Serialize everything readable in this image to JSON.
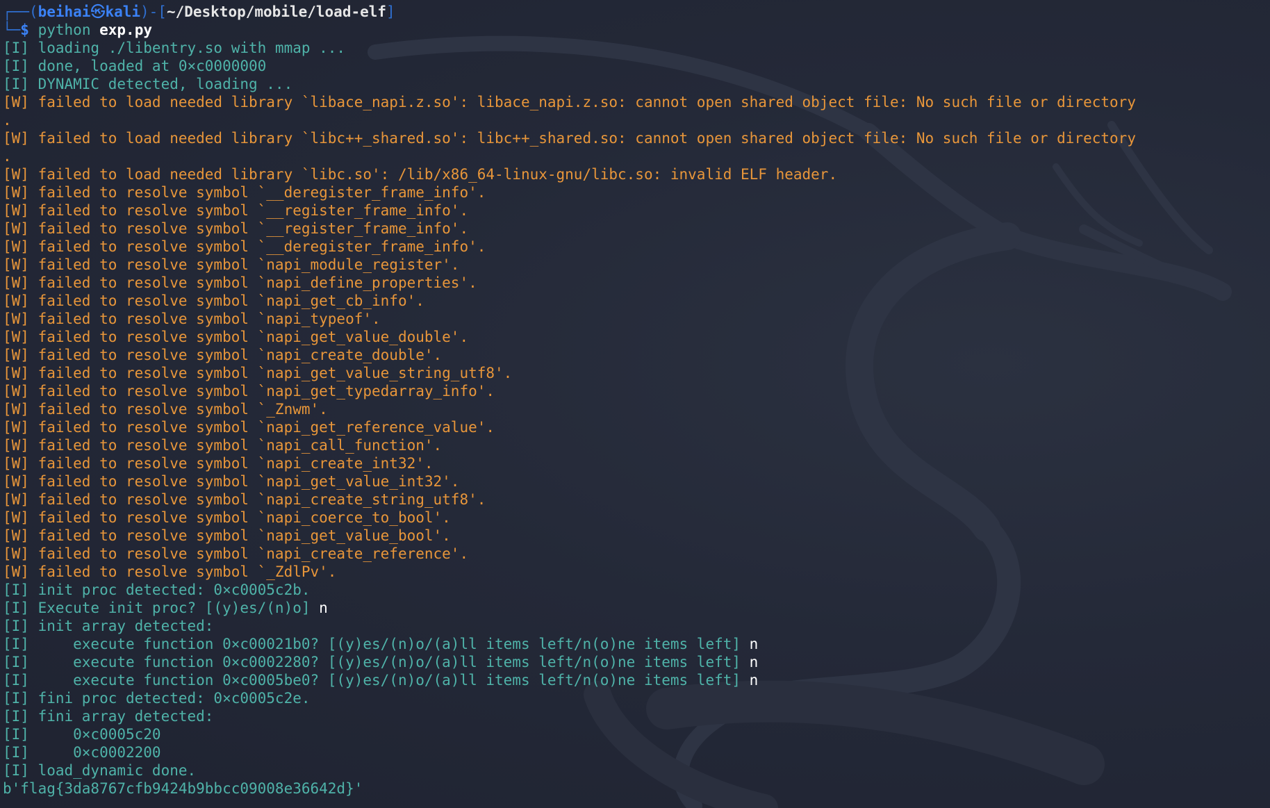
{
  "prompt": {
    "frame_top_left": "┌──(",
    "user": "beihai",
    "at_symbol": "㉿",
    "host": "kali",
    "frame_mid": ")-[",
    "path": "~/Desktop/mobile/load-elf",
    "frame_end": "]",
    "frame_bottom_left": "└─",
    "dollar": "$",
    "command": "python",
    "command_arg": "exp.py"
  },
  "output": [
    {
      "kind": "info",
      "text": "[I] loading ./libentry.so with mmap ..."
    },
    {
      "kind": "info",
      "text": "[I] done, loaded at 0×c0000000"
    },
    {
      "kind": "info",
      "text": "[I] DYNAMIC detected, loading ..."
    },
    {
      "kind": "warn",
      "text": "[W] failed to load needed library `libace_napi.z.so': libace_napi.z.so: cannot open shared object file: No such file or directory"
    },
    {
      "kind": "warn",
      "text": "."
    },
    {
      "kind": "warn",
      "text": "[W] failed to load needed library `libc++_shared.so': libc++_shared.so: cannot open shared object file: No such file or directory"
    },
    {
      "kind": "warn",
      "text": "."
    },
    {
      "kind": "warn",
      "text": "[W] failed to load needed library `libc.so': /lib/x86_64-linux-gnu/libc.so: invalid ELF header."
    },
    {
      "kind": "warn",
      "text": "[W] failed to resolve symbol `__deregister_frame_info'."
    },
    {
      "kind": "warn",
      "text": "[W] failed to resolve symbol `__register_frame_info'."
    },
    {
      "kind": "warn",
      "text": "[W] failed to resolve symbol `__register_frame_info'."
    },
    {
      "kind": "warn",
      "text": "[W] failed to resolve symbol `__deregister_frame_info'."
    },
    {
      "kind": "warn",
      "text": "[W] failed to resolve symbol `napi_module_register'."
    },
    {
      "kind": "warn",
      "text": "[W] failed to resolve symbol `napi_define_properties'."
    },
    {
      "kind": "warn",
      "text": "[W] failed to resolve symbol `napi_get_cb_info'."
    },
    {
      "kind": "warn",
      "text": "[W] failed to resolve symbol `napi_typeof'."
    },
    {
      "kind": "warn",
      "text": "[W] failed to resolve symbol `napi_get_value_double'."
    },
    {
      "kind": "warn",
      "text": "[W] failed to resolve symbol `napi_create_double'."
    },
    {
      "kind": "warn",
      "text": "[W] failed to resolve symbol `napi_get_value_string_utf8'."
    },
    {
      "kind": "warn",
      "text": "[W] failed to resolve symbol `napi_get_typedarray_info'."
    },
    {
      "kind": "warn",
      "text": "[W] failed to resolve symbol `_Znwm'."
    },
    {
      "kind": "warn",
      "text": "[W] failed to resolve symbol `napi_get_reference_value'."
    },
    {
      "kind": "warn",
      "text": "[W] failed to resolve symbol `napi_call_function'."
    },
    {
      "kind": "warn",
      "text": "[W] failed to resolve symbol `napi_create_int32'."
    },
    {
      "kind": "warn",
      "text": "[W] failed to resolve symbol `napi_get_value_int32'."
    },
    {
      "kind": "warn",
      "text": "[W] failed to resolve symbol `napi_create_string_utf8'."
    },
    {
      "kind": "warn",
      "text": "[W] failed to resolve symbol `napi_coerce_to_bool'."
    },
    {
      "kind": "warn",
      "text": "[W] failed to resolve symbol `napi_get_value_bool'."
    },
    {
      "kind": "warn",
      "text": "[W] failed to resolve symbol `napi_create_reference'."
    },
    {
      "kind": "warn",
      "text": "[W] failed to resolve symbol `_ZdlPv'."
    },
    {
      "kind": "info",
      "text": "[I] init proc detected: 0×c0005c2b."
    },
    {
      "kind": "info",
      "text": "[I] Execute init proc? [(y)es/(n)o] ",
      "answer": "n"
    },
    {
      "kind": "info",
      "text": "[I] init array detected:"
    },
    {
      "kind": "info",
      "text": "[I]     execute function 0×c00021b0? [(y)es/(n)o/(a)ll items left/n(o)ne items left] ",
      "answer": "n"
    },
    {
      "kind": "info",
      "text": "[I]     execute function 0×c0002280? [(y)es/(n)o/(a)ll items left/n(o)ne items left] ",
      "answer": "n"
    },
    {
      "kind": "info",
      "text": "[I]     execute function 0×c0005be0? [(y)es/(n)o/(a)ll items left/n(o)ne items left] ",
      "answer": "n"
    },
    {
      "kind": "info",
      "text": "[I] fini proc detected: 0×c0005c2e."
    },
    {
      "kind": "info",
      "text": "[I] fini array detected:"
    },
    {
      "kind": "info",
      "text": "[I]     0×c0005c20"
    },
    {
      "kind": "info",
      "text": "[I]     0×c0002200"
    },
    {
      "kind": "info",
      "text": "[I] load_dynamic done."
    },
    {
      "kind": "plain",
      "text": "b'flag{3da8767cfb9424b9bbcc09008e36642d}'"
    }
  ],
  "colors": {
    "background": "#232837",
    "info": "#4fb3a9",
    "warn": "#e8963a",
    "prompt_blue": "#3b82f6",
    "path": "#e6e6e6"
  }
}
